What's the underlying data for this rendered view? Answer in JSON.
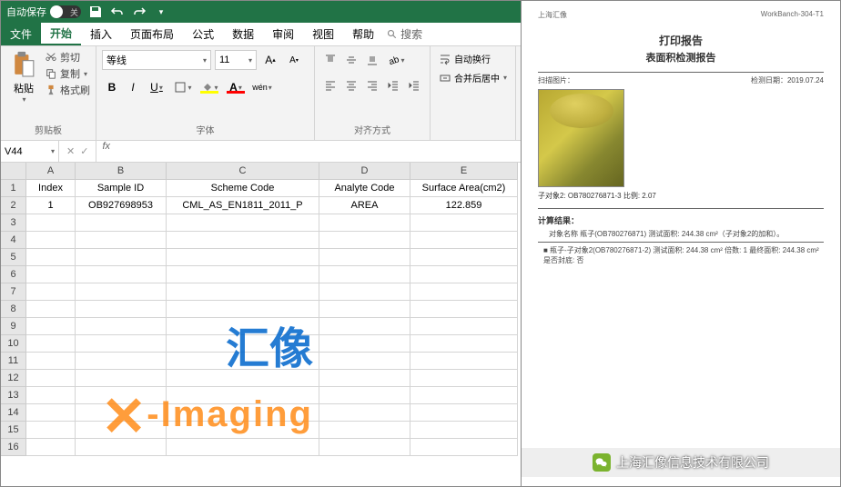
{
  "titlebar": {
    "autosave_label": "自动保存",
    "toggle_state": "关"
  },
  "menu": {
    "file": "文件",
    "home": "开始",
    "insert": "插入",
    "pagelayout": "页面布局",
    "formulas": "公式",
    "data": "数据",
    "review": "审阅",
    "view": "视图",
    "help": "帮助",
    "search": "搜索"
  },
  "ribbon": {
    "clipboard": {
      "paste": "粘贴",
      "cut": "剪切",
      "copy": "复制",
      "format_painter": "格式刷",
      "group_label": "剪贴板"
    },
    "font": {
      "name": "等线",
      "size": "11",
      "group_label": "字体",
      "bold": "B",
      "italic": "I",
      "underline": "U",
      "pinyin": "wén"
    },
    "alignment": {
      "group_label": "对齐方式",
      "wrap": "自动换行",
      "merge": "合并后居中"
    }
  },
  "namebox": {
    "value": "V44"
  },
  "table": {
    "col_headers": [
      "A",
      "B",
      "C",
      "D",
      "E"
    ],
    "headers": [
      "Index",
      "Sample ID",
      "Scheme Code",
      "Analyte Code",
      "Surface Area(cm2)"
    ],
    "row": {
      "index": "1",
      "sample_id": "OB927698953",
      "scheme_code": "CML_AS_EN1811_2011_P",
      "analyte_code": "AREA",
      "surface_area": "122.859"
    }
  },
  "watermark": {
    "cn": "汇像",
    "en": "-Imaging"
  },
  "report": {
    "company": "上海汇像",
    "workbanch": "WorkBanch-304-T1",
    "title": "打印报告",
    "subtitle": "表面积检测报告",
    "scan_label": "扫描图片：",
    "date_label": "检测日期：",
    "date": "2019.07.24",
    "caption": "子对象2: OB780276871-3 比例: 2.07",
    "result_title": "计算结果：",
    "line1": "对象名称 瓶子(OB780276871) 测试面积: 244.38 cm²（子对象2的加和）。",
    "line2": "瓶子-子对象2(OB780276871-2)  测试面积: 244.38 cm²  倍数: 1  最终面积: 244.38 cm²  是否封底: 否"
  },
  "wechat": {
    "text": "上海汇像信息技术有限公司"
  }
}
